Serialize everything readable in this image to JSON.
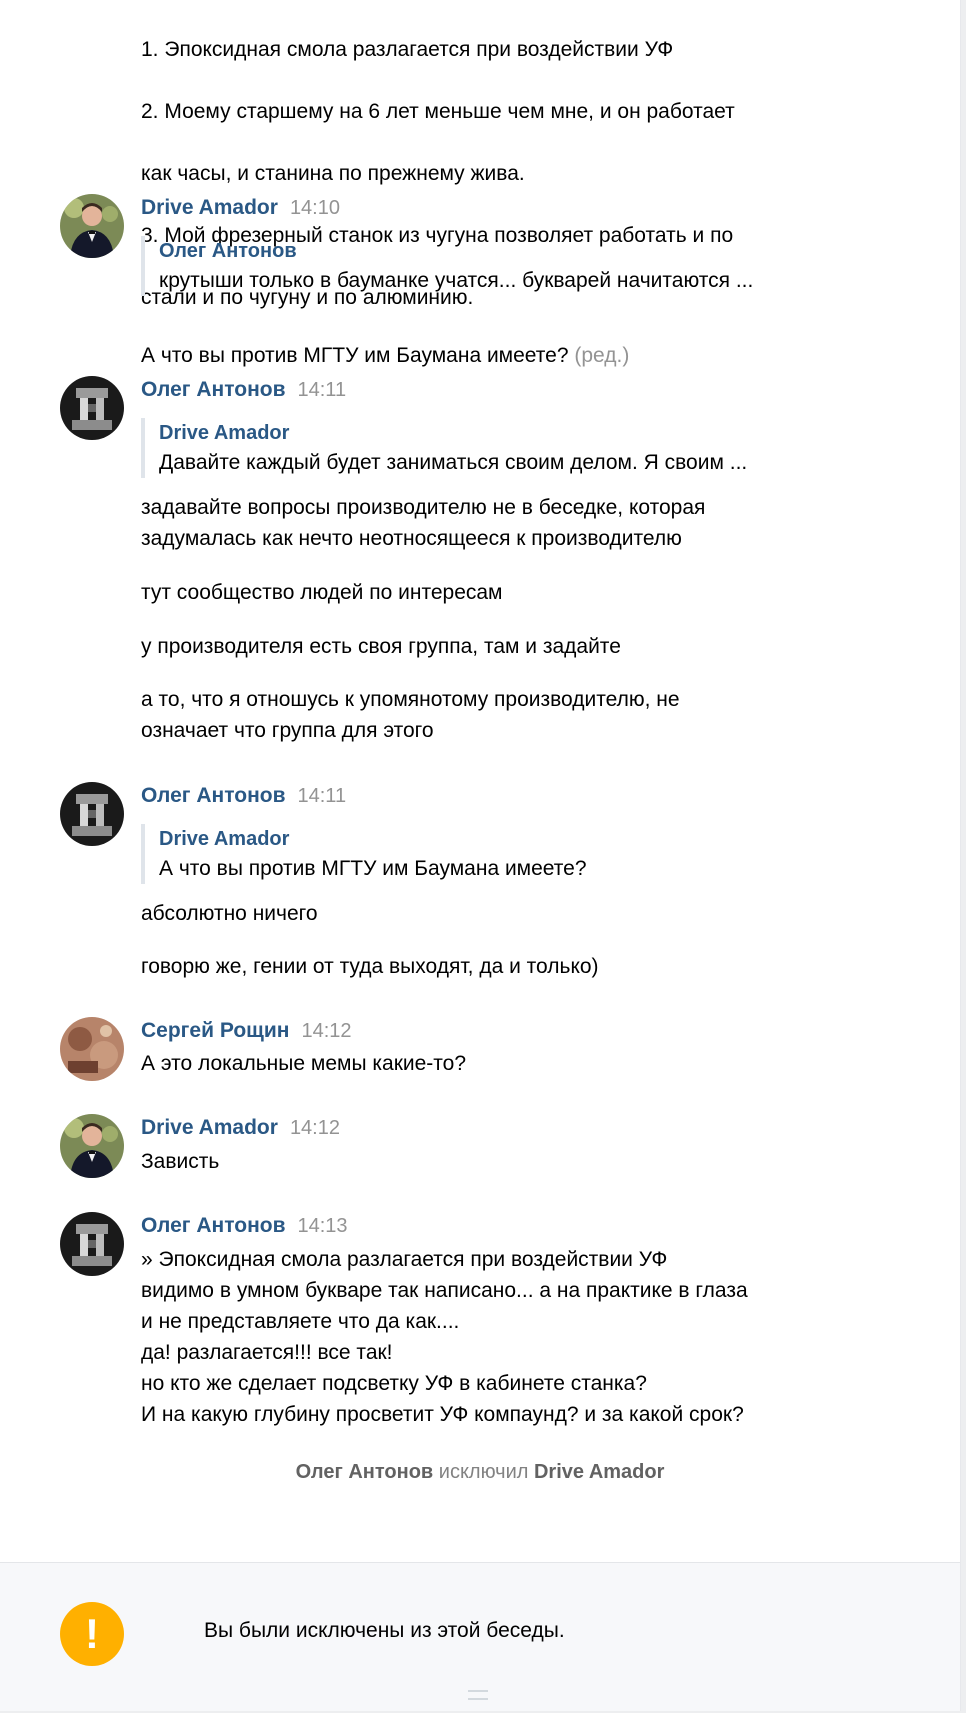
{
  "messages": {
    "m0": {
      "lines": [
        "1. Эпоксидная смола разлагается при воздействии УФ",
        "2. Моему старшему на 6 лет меньше чем мне, и он работает",
        "как часы, и станина по прежнему жива.",
        "3. Мой фрезерный станок из чугуна позволяет работать и по",
        "стали и по чугуну и по алюминию."
      ]
    },
    "m1": {
      "author": "Drive Amador",
      "time": "14:10",
      "quote_author": "Олег Антонов",
      "quote_text": "крутыши только в бауманке учатся... букварей начитаются ...",
      "text": "А что вы против МГТУ им Баумана имеете?",
      "edited": "(ред.)"
    },
    "m2": {
      "author": "Олег Антонов",
      "time": "14:11",
      "quote_author": "Drive Amador",
      "quote_text": "Давайте каждый будет заниматься своим делом. Я своим ...",
      "p1": "задавайте вопросы производителю не в беседке, которая\nзадумалась как нечто неотносящееся к производителю",
      "p2": "тут сообщество людей по интересам",
      "p3": "у производителя есть своя группа, там и задайте",
      "p4": "а то, что я отношусь к упомянотому производителю, не\nозначает что группа для этого"
    },
    "m3": {
      "author": "Олег Антонов",
      "time": "14:11",
      "quote_author": "Drive Amador",
      "quote_text": "А что вы против МГТУ им Баумана имеете?",
      "p1": "абсолютно ничего",
      "p2": "говорю же, гении от туда выходят, да и только)"
    },
    "m4": {
      "author": "Сергей Рощин",
      "time": "14:12",
      "text": "А это локальные мемы какие-то?"
    },
    "m5": {
      "author": "Drive Amador",
      "time": "14:12",
      "text": "Зависть"
    },
    "m6": {
      "author": "Олег Антонов",
      "time": "14:13",
      "text": "» Эпоксидная смола разлагается при воздействии УФ\nвидимо в умном букваре так написано... а на практике в глаза\nи не представляете что да как....\nда! разлагается!!! все так!\nно кто же сделает подсветку УФ в кабинете станка?\nИ на какую глубину просветит УФ компаунд? и за какой срок?"
    }
  },
  "service": {
    "actor": "Олег Антонов",
    "action": "исключил",
    "target": "Drive Amador"
  },
  "footer": {
    "text": "Вы были исключены из этой беседы.",
    "icon": "exclamation-icon",
    "icon_color": "#ffb000"
  }
}
